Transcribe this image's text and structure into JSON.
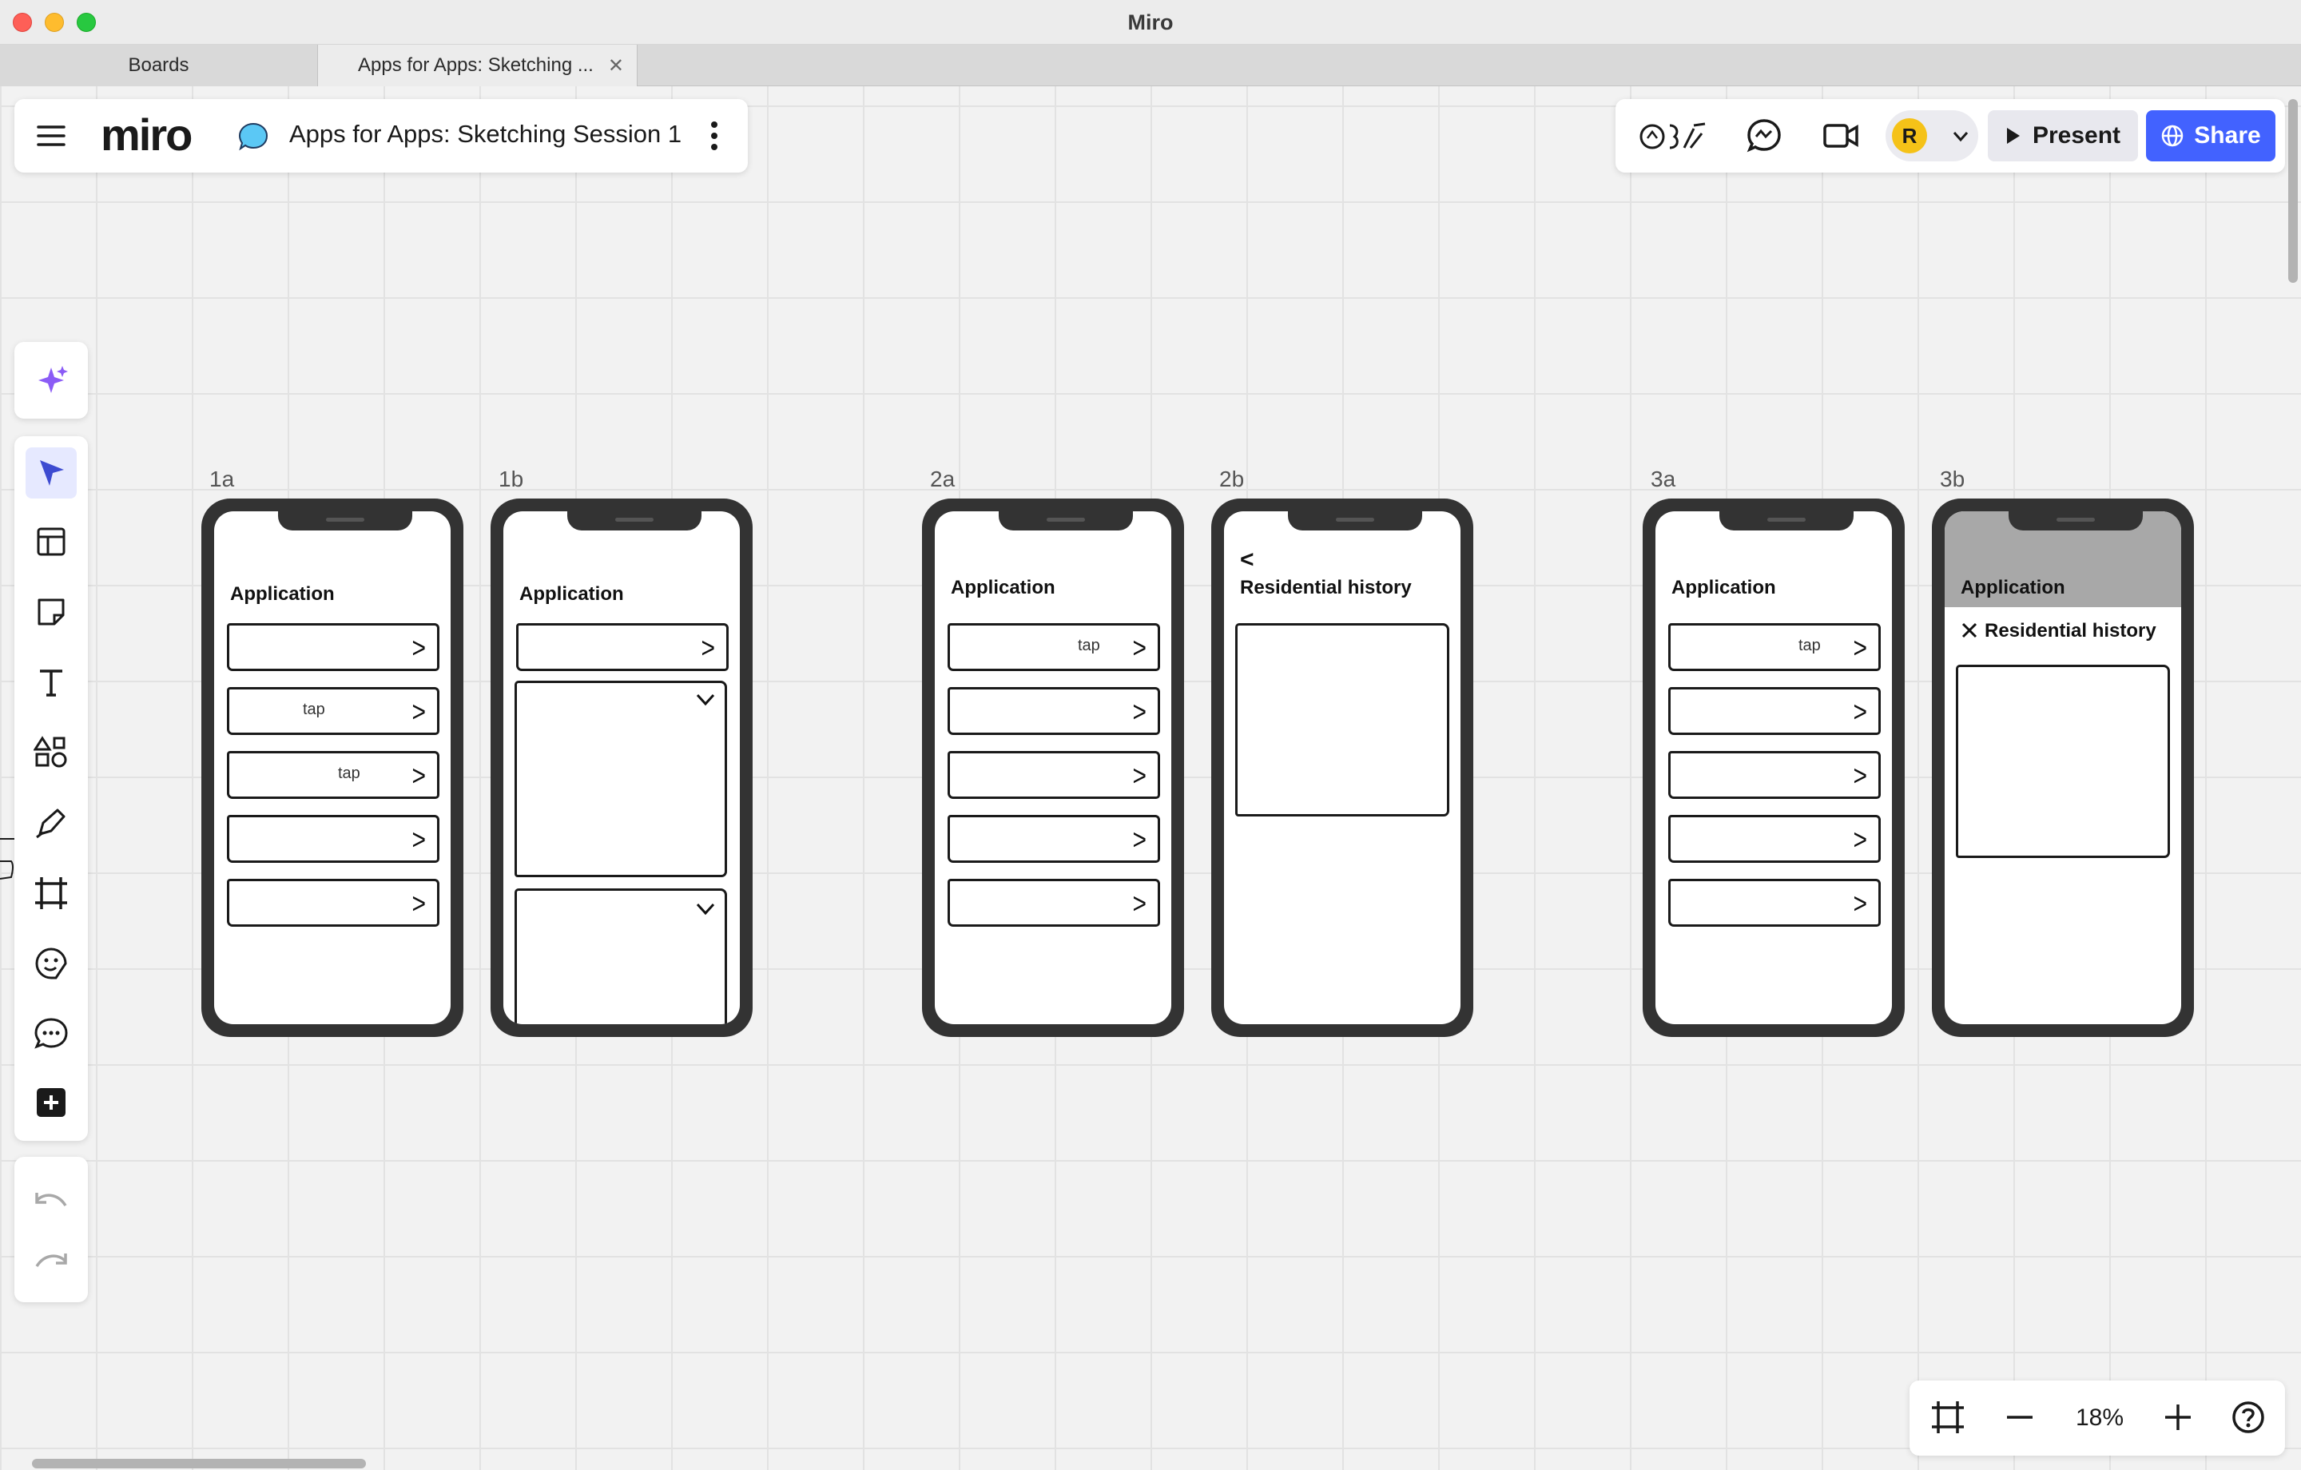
{
  "window": {
    "title": "Miro"
  },
  "tabs": [
    {
      "label": "Boards"
    },
    {
      "label": "Apps for Apps: Sketching ..."
    }
  ],
  "header": {
    "logo": "miro",
    "board_name": "Apps for Apps: Sketching Session 1"
  },
  "collab": {
    "avatar_initial": "R",
    "present_label": "Present",
    "share_label": "Share"
  },
  "zoom": {
    "level": "18%"
  },
  "frames": [
    {
      "label": "1a",
      "title": "Application",
      "taps": [
        "tap",
        "tap"
      ]
    },
    {
      "label": "1b",
      "title": "Application"
    },
    {
      "label": "2a",
      "title": "Application",
      "taps": [
        "tap"
      ]
    },
    {
      "label": "2b",
      "back": "<",
      "title": "Residential history"
    },
    {
      "label": "3a",
      "title": "Application",
      "taps": [
        "tap"
      ]
    },
    {
      "label": "3b",
      "title": "Application",
      "subtitle": "Residential history"
    }
  ],
  "colors": {
    "accent": "#4262ff",
    "avatar": "#f5c218",
    "ai_sparkle": "#8b5cf6"
  }
}
